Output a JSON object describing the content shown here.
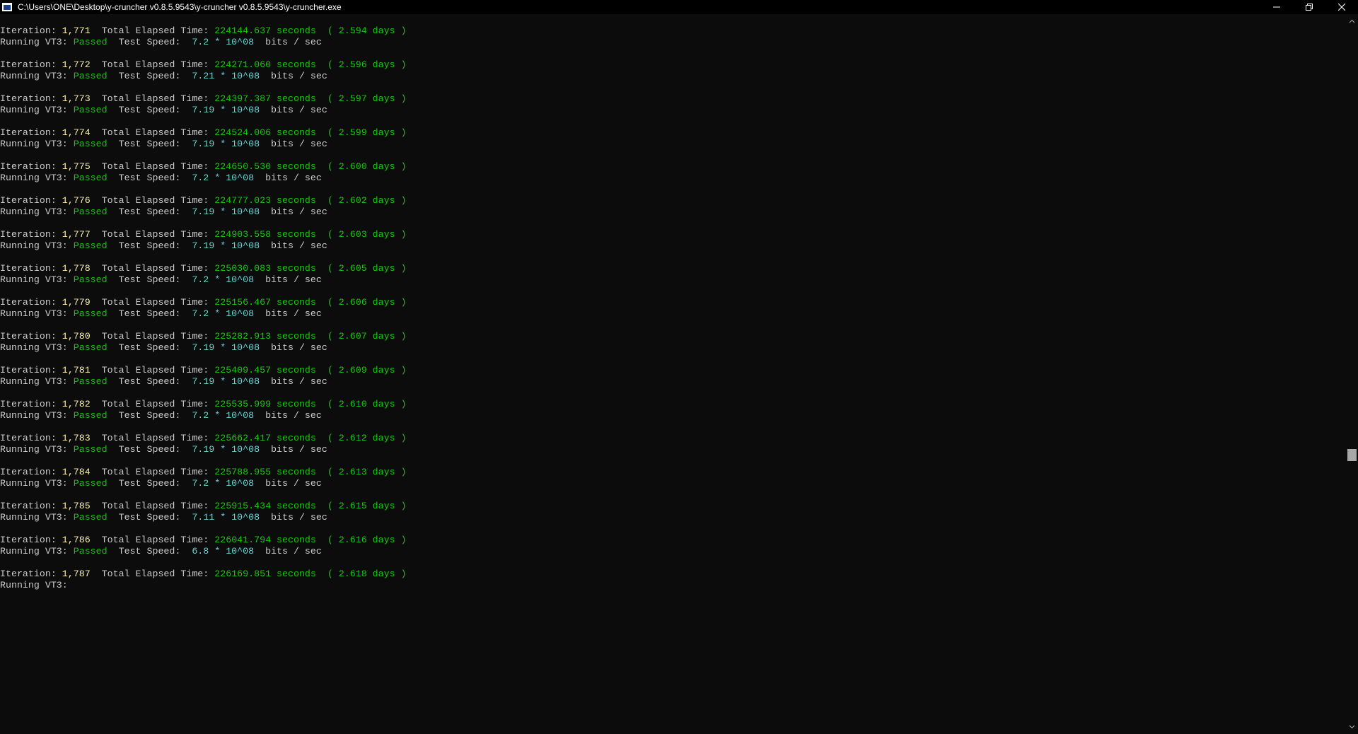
{
  "window": {
    "title": "C:\\Users\\ONE\\Desktop\\y-cruncher v0.8.5.9543\\y-cruncher v0.8.5.9543\\y-cruncher.exe",
    "controls": {
      "minimize": "minimize-icon",
      "restore": "restore-icon",
      "close": "close-icon"
    }
  },
  "colors": {
    "background": "#0c0c0c",
    "text": "#cccccc",
    "iteration_number": "#f9f1a5",
    "elapsed_green": "#16c60c",
    "speed_cyan": "#61d6d6"
  },
  "labels": {
    "iteration": "Iteration: ",
    "total_elapsed": "  Total Elapsed Time: ",
    "running": "Running VT3: ",
    "test_speed": "  Test Speed:  ",
    "unit": "  bits / sec"
  },
  "console": {
    "entries": [
      {
        "iteration": "1,771",
        "seconds": "224144.637 seconds",
        "days": "  ( 2.594 days )",
        "status": "Passed",
        "speed": "7.2 * 10^08"
      },
      {
        "iteration": "1,772",
        "seconds": "224271.060 seconds",
        "days": "  ( 2.596 days )",
        "status": "Passed",
        "speed": "7.21 * 10^08"
      },
      {
        "iteration": "1,773",
        "seconds": "224397.387 seconds",
        "days": "  ( 2.597 days )",
        "status": "Passed",
        "speed": "7.19 * 10^08"
      },
      {
        "iteration": "1,774",
        "seconds": "224524.006 seconds",
        "days": "  ( 2.599 days )",
        "status": "Passed",
        "speed": "7.19 * 10^08"
      },
      {
        "iteration": "1,775",
        "seconds": "224650.530 seconds",
        "days": "  ( 2.600 days )",
        "status": "Passed",
        "speed": "7.2 * 10^08"
      },
      {
        "iteration": "1,776",
        "seconds": "224777.023 seconds",
        "days": "  ( 2.602 days )",
        "status": "Passed",
        "speed": "7.19 * 10^08"
      },
      {
        "iteration": "1,777",
        "seconds": "224903.558 seconds",
        "days": "  ( 2.603 days )",
        "status": "Passed",
        "speed": "7.19 * 10^08"
      },
      {
        "iteration": "1,778",
        "seconds": "225030.083 seconds",
        "days": "  ( 2.605 days )",
        "status": "Passed",
        "speed": "7.2 * 10^08"
      },
      {
        "iteration": "1,779",
        "seconds": "225156.467 seconds",
        "days": "  ( 2.606 days )",
        "status": "Passed",
        "speed": "7.2 * 10^08"
      },
      {
        "iteration": "1,780",
        "seconds": "225282.913 seconds",
        "days": "  ( 2.607 days )",
        "status": "Passed",
        "speed": "7.19 * 10^08"
      },
      {
        "iteration": "1,781",
        "seconds": "225409.457 seconds",
        "days": "  ( 2.609 days )",
        "status": "Passed",
        "speed": "7.19 * 10^08"
      },
      {
        "iteration": "1,782",
        "seconds": "225535.999 seconds",
        "days": "  ( 2.610 days )",
        "status": "Passed",
        "speed": "7.2 * 10^08"
      },
      {
        "iteration": "1,783",
        "seconds": "225662.417 seconds",
        "days": "  ( 2.612 days )",
        "status": "Passed",
        "speed": "7.19 * 10^08"
      },
      {
        "iteration": "1,784",
        "seconds": "225788.955 seconds",
        "days": "  ( 2.613 days )",
        "status": "Passed",
        "speed": "7.2 * 10^08"
      },
      {
        "iteration": "1,785",
        "seconds": "225915.434 seconds",
        "days": "  ( 2.615 days )",
        "status": "Passed",
        "speed": "7.11 * 10^08"
      },
      {
        "iteration": "1,786",
        "seconds": "226041.794 seconds",
        "days": "  ( 2.616 days )",
        "status": "Passed",
        "speed": "6.8 * 10^08"
      },
      {
        "iteration": "1,787",
        "seconds": "226169.851 seconds",
        "days": "  ( 2.618 days )",
        "status": "",
        "speed": ""
      }
    ]
  },
  "scrollbar": {
    "position": 0.62
  }
}
